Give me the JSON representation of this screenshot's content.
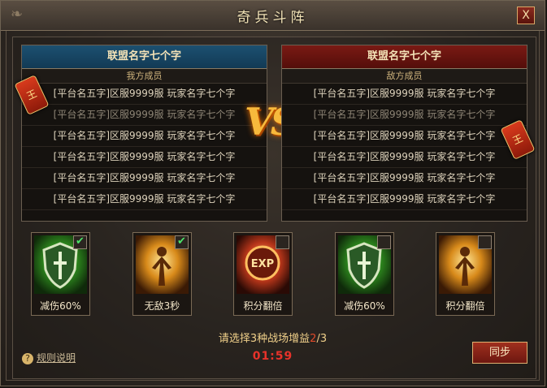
{
  "window": {
    "title": "奇兵斗阵",
    "close_label": "X"
  },
  "teams": {
    "ally": {
      "name": "联盟名字七个字",
      "subtitle": "我方成员",
      "members": [
        "[平台名五字]区服9999服 玩家名字七个字",
        "[平台名五字]区服9999服 玩家名字七个字",
        "[平台名五字]区服9999服 玩家名字七个字",
        "[平台名五字]区服9999服 玩家名字七个字",
        "[平台名五字]区服9999服 玩家名字七个字",
        "[平台名五字]区服9999服 玩家名字七个字"
      ]
    },
    "enemy": {
      "name": "联盟名字七个字",
      "subtitle": "敌方成员",
      "members": [
        "[平台名五字]区服9999服 玩家名字七个字",
        "[平台名五字]区服9999服 玩家名字七个字",
        "[平台名五字]区服9999服 玩家名字七个字",
        "[平台名五字]区服9999服 玩家名字七个字",
        "[平台名五字]区服9999服 玩家名字七个字",
        "[平台名五字]区服9999服 玩家名字七个字"
      ]
    }
  },
  "vs_label": "VS",
  "badge_text": "王",
  "buffs": [
    {
      "label": "减伤60%",
      "checked": true,
      "icon": "shield-icon"
    },
    {
      "label": "无敌3秒",
      "checked": true,
      "icon": "golden-aura-warrior-icon"
    },
    {
      "label": "积分翻倍",
      "checked": false,
      "icon": "exp-orb-icon",
      "icon_text": "EXP"
    },
    {
      "label": "减伤60%",
      "checked": false,
      "icon": "shield-icon"
    },
    {
      "label": "积分翻倍",
      "checked": false,
      "icon": "golden-aura-warrior-icon"
    }
  ],
  "footer": {
    "prompt_prefix": "请选择3种战场增益",
    "selected_count": "2",
    "prompt_suffix": "/3",
    "timer": "01:59",
    "help_icon": "?",
    "help_label": "规则说明",
    "sync_label": "同步"
  }
}
